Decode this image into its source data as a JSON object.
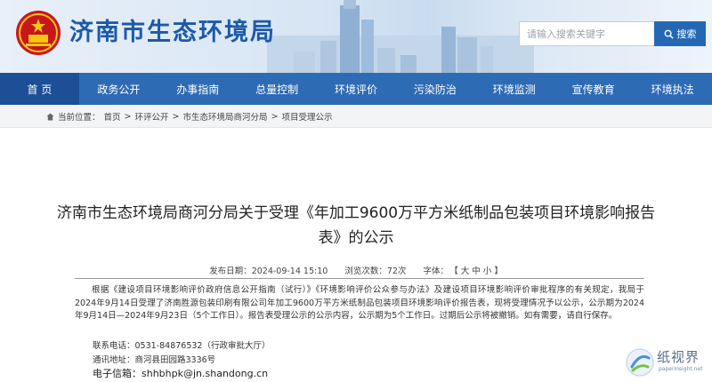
{
  "header": {
    "site_title": "济南市生态环境局",
    "search_placeholder": "请输入搜索关键字",
    "search_label": "搜索"
  },
  "nav": {
    "items": [
      "首 页",
      "政务公开",
      "办事指南",
      "总量控制",
      "环境评价",
      "污染防治",
      "环境监测",
      "宣传教育",
      "环境执法"
    ],
    "active_index": 0
  },
  "breadcrumb": {
    "prefix": "当前位置：",
    "items": [
      "首页",
      "环评公开",
      "市生态环境局商河分局",
      "项目受理公示"
    ],
    "separator": ">"
  },
  "article": {
    "title": "济南市生态环境局商河分局关于受理《年加工9600万平方米纸制品包装项目环境影响报告表》的公示",
    "publish_label": "发布日期：",
    "publish_date": "2024-09-14 15:10",
    "views_label": "浏览次数：",
    "views": "72次",
    "font_label": "字体：",
    "font_sizes": "【 大 中 小 】",
    "body": "根据《建设项目环境影响评价政府信息公开指南（试行）》《环境影响评价公众参与办法》及建设项目环境影响评价审批程序的有关规定，我局于2024年9月14日受理了济南胜源包装印刷有限公司年加工9600万平方米纸制品包装项目环境影响评价报告表，现将受理情况予以公示，公示期为2024年9月14日—2024年9月23日（5个工作日）。报告表受理公示的公示内容，公示期为5个工作日。过期后公示将被撤销。如有需要，请自行保存。",
    "phone_line": "联系电话：0531-84876532（行政审批大厅）",
    "address_line": "通讯地址：商河县田园路3336号",
    "email_line": "电子信箱：shhbhpk@jn.shandong.cn"
  },
  "watermark": {
    "text": "纸视界",
    "sub": "paperinsight.net"
  },
  "colors": {
    "brand": "#1c5aa8",
    "nav_bg": "#2e6bb5",
    "nav_active": "#1c4f96",
    "search_button": "#2468b4"
  }
}
